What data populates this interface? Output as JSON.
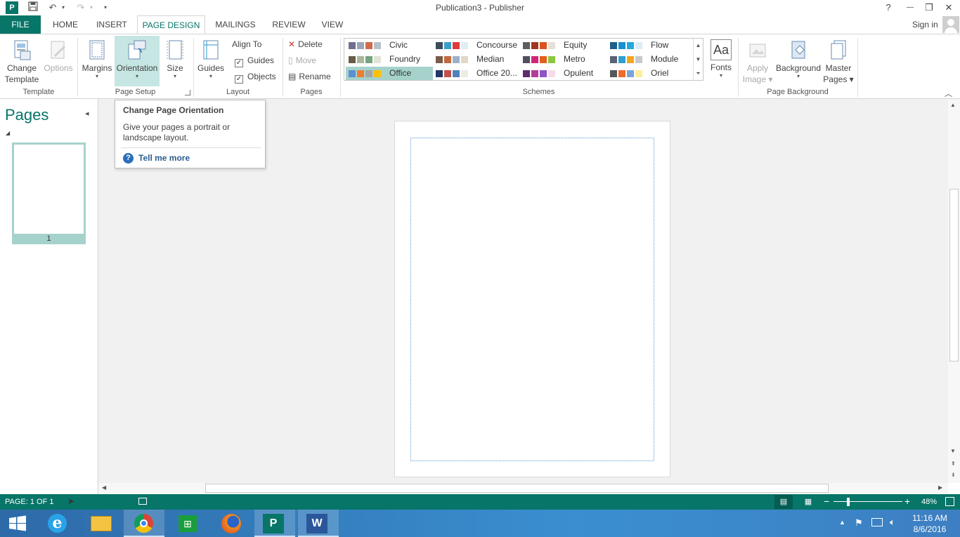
{
  "window": {
    "title": "Publication3 - Publisher",
    "help_glyph": "?",
    "minimize_glyph": "—",
    "restore_glyph": "❐",
    "close_glyph": "✕"
  },
  "quick_access": {
    "undo_glyph": "↶",
    "redo_glyph": "↷",
    "more_glyph": "▾"
  },
  "tabs": [
    {
      "label": "FILE"
    },
    {
      "label": "HOME"
    },
    {
      "label": "INSERT"
    },
    {
      "label": "PAGE DESIGN"
    },
    {
      "label": "MAILINGS"
    },
    {
      "label": "REVIEW"
    },
    {
      "label": "VIEW"
    }
  ],
  "sign_in": "Sign in",
  "ribbon": {
    "template": {
      "change_template": [
        "Change",
        "Template"
      ],
      "options": "Options",
      "group": "Template"
    },
    "page_setup": {
      "margins": "Margins",
      "orientation": "Orientation",
      "size": "Size",
      "group": "Page Setup"
    },
    "layout": {
      "guides": "Guides",
      "align_to": "Align To",
      "guides_check": "Guides",
      "objects_check": "Objects",
      "group": "Layout"
    },
    "pages": {
      "delete": "Delete",
      "move": "Move",
      "rename": "Rename",
      "group": "Pages"
    },
    "schemes": {
      "group": "Schemes",
      "items": [
        {
          "name": "Civic",
          "colors": [
            "#6f6f8f",
            "#9aa6b8",
            "#d06b4a",
            "#b7c1c9"
          ]
        },
        {
          "name": "Concourse",
          "colors": [
            "#3e4b5a",
            "#3aa0c8",
            "#e03b3b",
            "#ddeef4"
          ]
        },
        {
          "name": "Equity",
          "colors": [
            "#5e5e5e",
            "#a1351f",
            "#d9541e",
            "#e6e0d6"
          ]
        },
        {
          "name": "Flow",
          "colors": [
            "#1f5f8b",
            "#1a8fd0",
            "#23a8e0",
            "#dbeef8"
          ]
        },
        {
          "name": "Foundry",
          "colors": [
            "#665d48",
            "#a9b79b",
            "#76a47f",
            "#e0e3d6"
          ]
        },
        {
          "name": "Median",
          "colors": [
            "#7a5c4b",
            "#c26a3d",
            "#9cb0c8",
            "#e3d7c6"
          ]
        },
        {
          "name": "Metro",
          "colors": [
            "#4f4f5f",
            "#d1247a",
            "#e45f1b",
            "#8dc63f"
          ]
        },
        {
          "name": "Module",
          "colors": [
            "#5a6273",
            "#2e9fd1",
            "#f3a51c",
            "#c7c9cd"
          ]
        },
        {
          "name": "Office",
          "colors": [
            "#5b8fd0",
            "#ef7d31",
            "#a5a5a5",
            "#ffc000"
          ]
        },
        {
          "name": "Office 20...",
          "colors": [
            "#1f3864",
            "#c0504d",
            "#4f81bd",
            "#eeece1"
          ]
        },
        {
          "name": "Opulent",
          "colors": [
            "#5e2b6f",
            "#b43c9b",
            "#8c54c5",
            "#f5dce8"
          ]
        },
        {
          "name": "Oriel",
          "colors": [
            "#56575a",
            "#f06a2a",
            "#7aa4d8",
            "#ffef9a"
          ]
        }
      ]
    },
    "fonts": {
      "glyph": "Aa",
      "label": "Fonts"
    },
    "page_background": {
      "apply_image": [
        "Apply",
        "Image"
      ],
      "background": "Background",
      "master_pages": [
        "Master",
        "Pages"
      ],
      "group": "Page Background"
    }
  },
  "tooltip": {
    "title": "Change Page Orientation",
    "body": "Give your pages a portrait or landscape layout.",
    "link": "Tell me more"
  },
  "pages_pane": {
    "title": "Pages",
    "collapse_glyph": "◂",
    "thumb_number": "1"
  },
  "status": {
    "page": "PAGE: 1 OF 1",
    "zoom": "48%"
  },
  "taskbar": {
    "time": "11:16 AM",
    "date": "8/6/2016"
  }
}
